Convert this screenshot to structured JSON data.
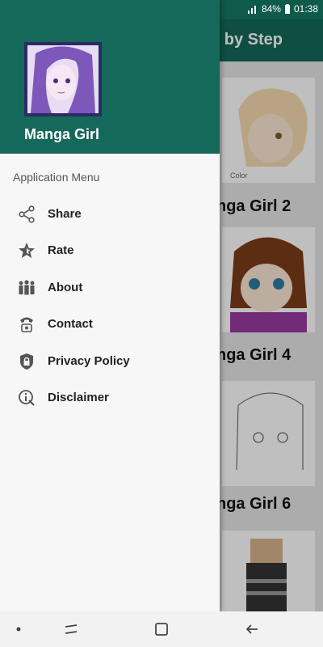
{
  "status": {
    "battery": "84%",
    "time": "01:38"
  },
  "appbar": {
    "title_fragment": "p by Step"
  },
  "cards": [
    {
      "title": "nga Girl 2",
      "sub": "Color"
    },
    {
      "title": "nga Girl 4"
    },
    {
      "title": "nga Girl 6"
    }
  ],
  "drawer": {
    "app_name": "Manga Girl",
    "section_title": "Application Menu",
    "items": [
      {
        "label": "Share",
        "icon": "share-icon"
      },
      {
        "label": "Rate",
        "icon": "star-icon"
      },
      {
        "label": "About",
        "icon": "people-icon"
      },
      {
        "label": "Contact",
        "icon": "phone-icon"
      },
      {
        "label": "Privacy Policy",
        "icon": "lock-icon"
      },
      {
        "label": "Disclaimer",
        "icon": "info-icon"
      }
    ]
  },
  "colors": {
    "primary": "#15695a",
    "primary_dark": "#0f5a4b",
    "drawer_bg": "#f7f7f7"
  }
}
